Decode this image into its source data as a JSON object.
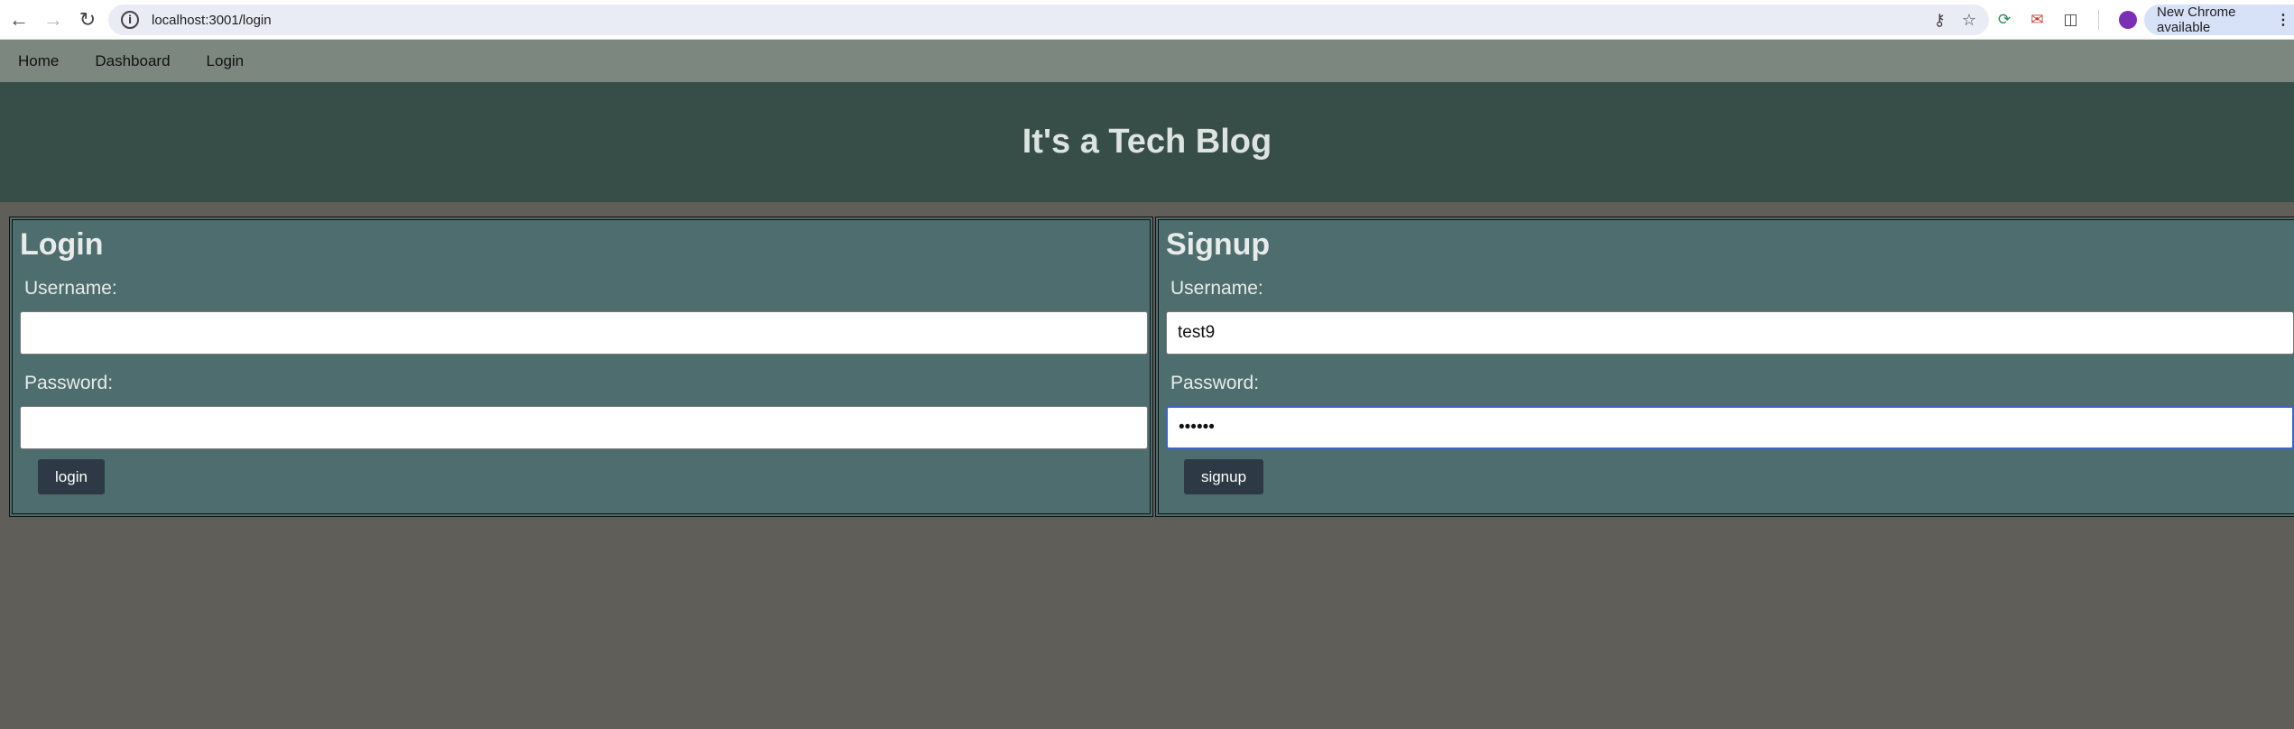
{
  "browser": {
    "url": "localhost:3001/login",
    "update_label": "New Chrome available"
  },
  "nav": {
    "items": [
      "Home",
      "Dashboard",
      "Login"
    ]
  },
  "header": {
    "title": "It's a Tech Blog"
  },
  "login": {
    "title": "Login",
    "username_label": "Username:",
    "username_value": "",
    "password_label": "Password:",
    "password_value": "",
    "button_label": "login"
  },
  "signup": {
    "title": "Signup",
    "username_label": "Username:",
    "username_value": "test9",
    "password_label": "Password:",
    "password_value": "123456",
    "button_label": "signup"
  },
  "colors": {
    "nav_bg": "#7c8780",
    "header_bg": "#374d47",
    "panel_bg": "#4e6d6e",
    "page_bg": "#5f5e59",
    "button_bg": "#2d3a45"
  }
}
